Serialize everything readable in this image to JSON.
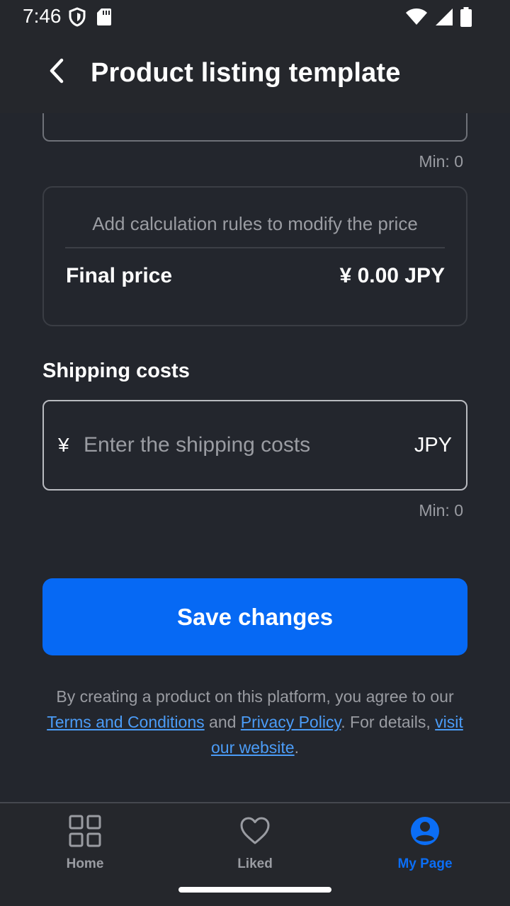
{
  "status_bar": {
    "time": "7:46",
    "icons": [
      "shield-icon",
      "sd-card-icon",
      "wifi-icon",
      "signal-icon",
      "battery-icon"
    ]
  },
  "app_bar": {
    "title": "Product listing template",
    "back_icon": "chevron-left-icon"
  },
  "price_section": {
    "min_label": "Min: 0",
    "hint": "Add calculation rules to modify the price",
    "final_price_label": "Final price",
    "final_price_value": "¥ 0.00 JPY"
  },
  "shipping": {
    "title": "Shipping costs",
    "currency_symbol": "¥",
    "placeholder": "Enter the shipping costs",
    "value": "",
    "currency_code": "JPY",
    "min_label": "Min: 0"
  },
  "save_button": {
    "label": "Save changes"
  },
  "legal": {
    "prefix": "By creating a product on this platform, you agree to our ",
    "terms_link": "Terms and Conditions",
    "and": " and ",
    "privacy_link": "Privacy Policy",
    "details": ". For details, ",
    "website_link": "visit our website",
    "suffix": "."
  },
  "bottom_nav": {
    "items": [
      {
        "label": "Home",
        "icon": "grid-icon",
        "active": false
      },
      {
        "label": "Liked",
        "icon": "heart-icon",
        "active": false
      },
      {
        "label": "My Page",
        "icon": "user-circle-icon",
        "active": true
      }
    ]
  },
  "colors": {
    "background": "#23262d",
    "accent": "#0669f4",
    "link": "#4b9cf7",
    "muted_text": "#9a9ca2"
  }
}
